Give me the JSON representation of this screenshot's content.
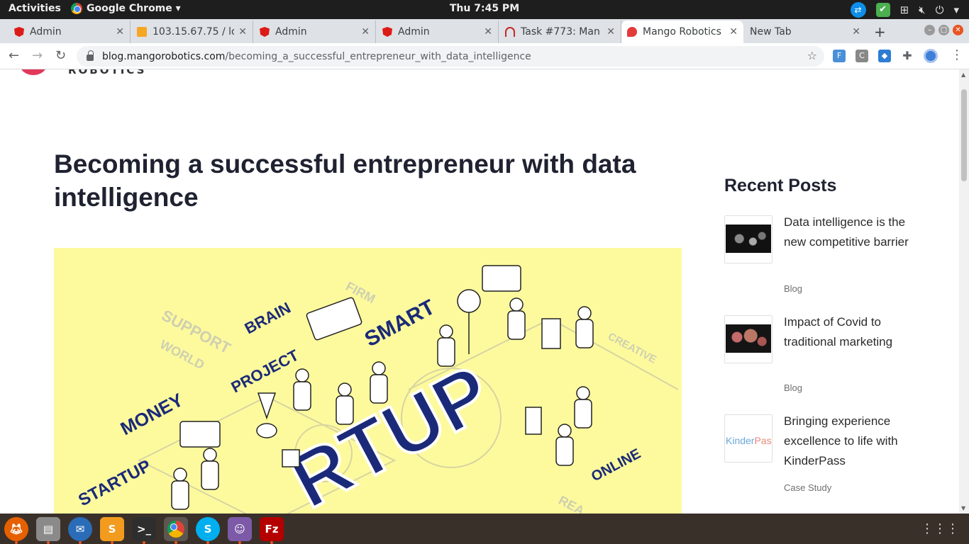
{
  "topbar": {
    "activities": "Activities",
    "app_name": "Google Chrome ▾",
    "clock": "Thu  7:45 PM",
    "tray_icons": [
      "teamviewer-icon",
      "security-check-icon",
      "network-icon",
      "volume-mute-icon",
      "power-icon"
    ]
  },
  "tabs": [
    {
      "title": "Admin",
      "icon": "angular-icon"
    },
    {
      "title": "103.15.67.75 / lo",
      "icon": "phpmyadmin-icon"
    },
    {
      "title": "Admin",
      "icon": "angular-icon"
    },
    {
      "title": "Admin",
      "icon": "angular-icon"
    },
    {
      "title": "Task #773: Man",
      "icon": "task-icon"
    },
    {
      "title": "Mango Robotics",
      "icon": "mango-icon",
      "active": true
    },
    {
      "title": "New Tab",
      "icon": ""
    }
  ],
  "toolbar": {
    "url_domain": "blog.mangorobotics.com",
    "url_path": "/becoming_a_successful_entrepreneur_with_data_intelligence"
  },
  "page": {
    "logo_text": "ROBOTICS",
    "post_title": "Becoming a successful entrepreneur with data intelligence",
    "hero_words": {
      "support": "SUPPORT",
      "world": "WORLD",
      "brain": "BRAIN",
      "firm": "FIRM",
      "smart": "SMART",
      "project": "PROJECT",
      "money": "MONEY",
      "startup": "STARTUP",
      "creative": "CREATIVE",
      "online": "ONLINE",
      "rtup": "RTUP",
      "rea": "REA"
    },
    "sidebar": {
      "title": "Recent Posts",
      "posts": [
        {
          "title": "Data intelligence is the new competitive barrier",
          "category": "Blog"
        },
        {
          "title": "Impact of Covid to traditional marketing",
          "category": "Blog"
        },
        {
          "title": "Bringing experience excellence to life with KinderPass",
          "category": "Case Study",
          "thumb_text_a": "Kinder",
          "thumb_text_b": "Pass"
        }
      ]
    }
  },
  "dock": {
    "apps": [
      "firefox-icon",
      "files-icon",
      "thunderbird-icon",
      "sublime-text-icon",
      "terminal-icon",
      "chrome-icon",
      "skype-icon",
      "pidgin-icon",
      "filezilla-icon"
    ],
    "active_app": "chrome-icon"
  }
}
